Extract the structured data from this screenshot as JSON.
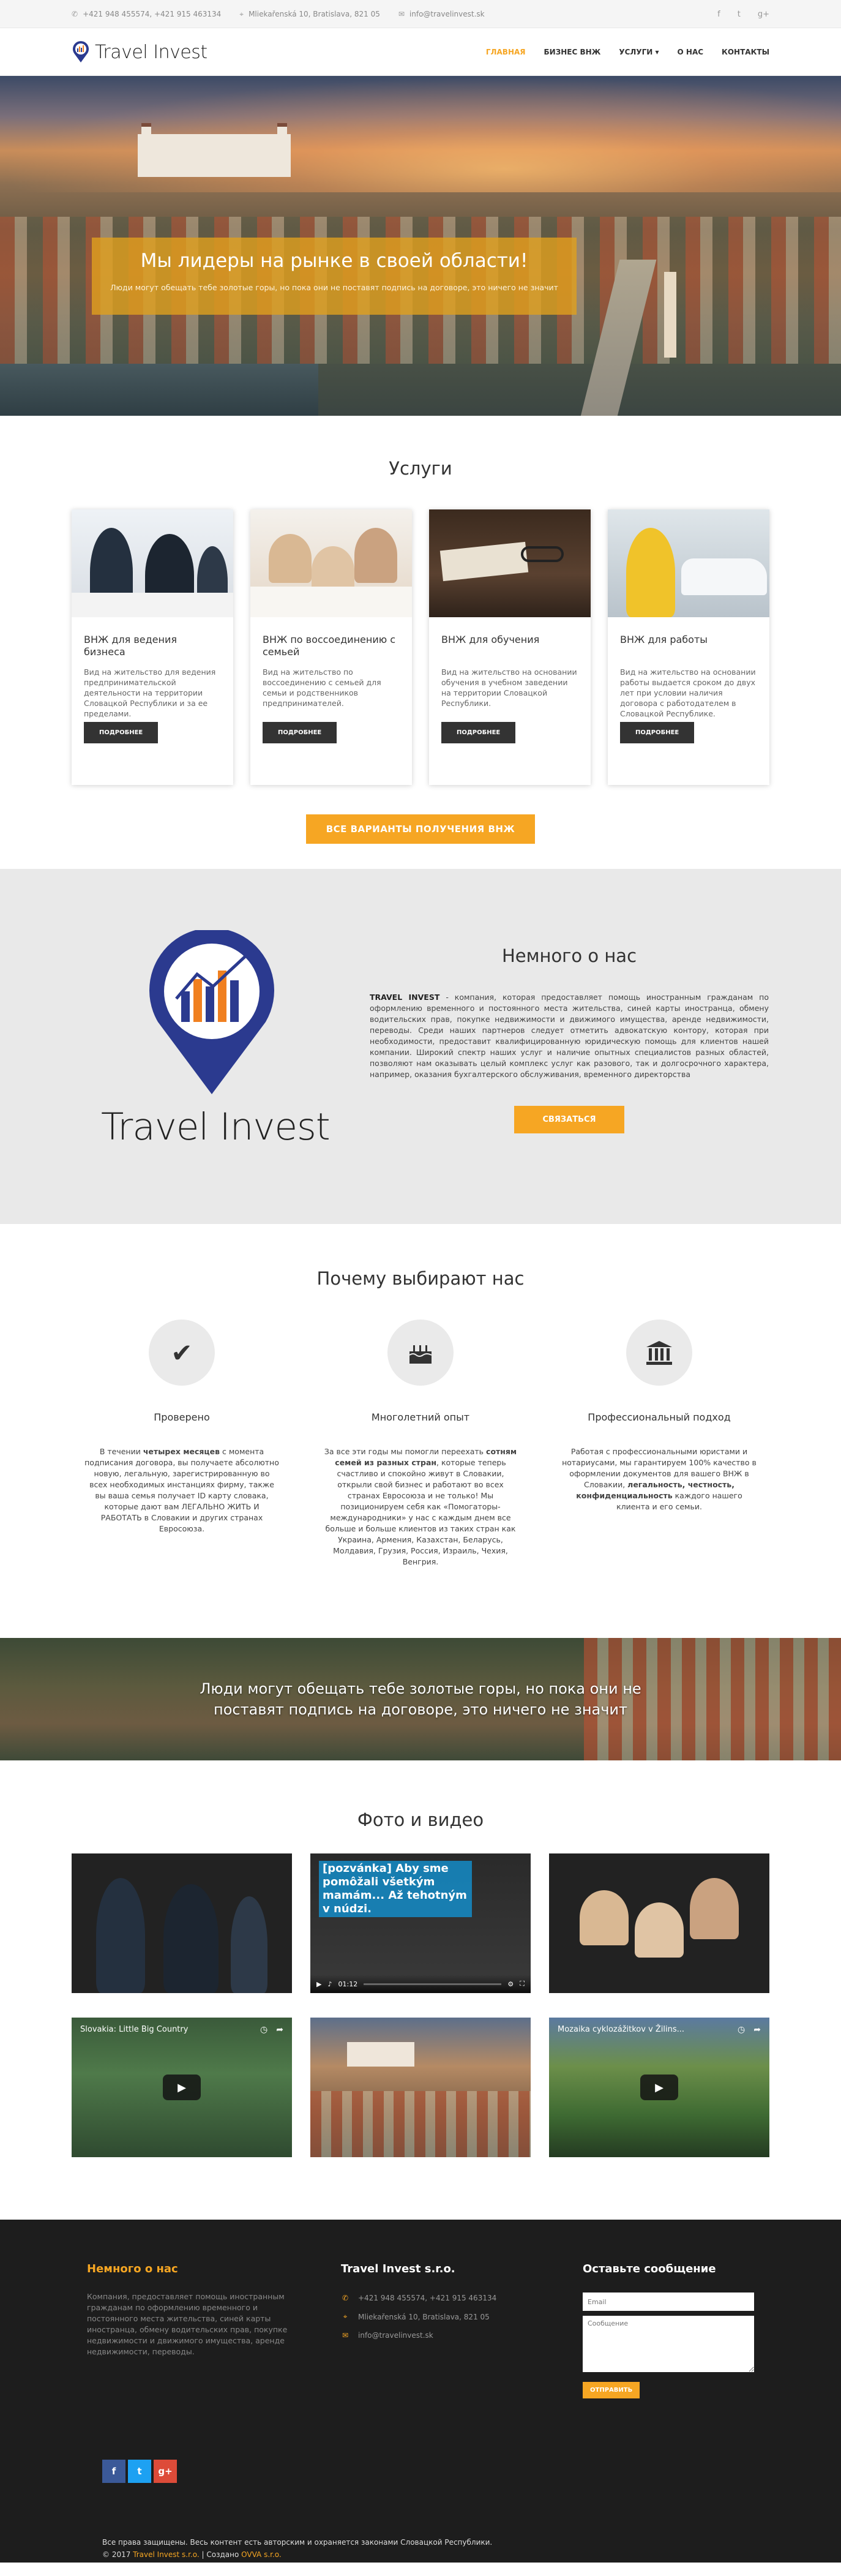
{
  "topbar": {
    "phone": "+421 948 455574, +421 915 463134",
    "address": "Mliekařenská 10, Bratislava, 821 05",
    "email": "info@travelinvest.sk",
    "social": [
      "f",
      "t",
      "g+"
    ]
  },
  "header": {
    "logo_text": "Travel Invest",
    "nav": [
      "Главная",
      "Бизнес ВНЖ",
      "Услуги ▾",
      "О нас",
      "Контакты"
    ]
  },
  "hero": {
    "title": "Мы лидеры на рынке в своей области!",
    "subtitle": "Люди могут обещать тебе золотые горы, но пока они не поставят подпись на договоре, это ничего не значит"
  },
  "services": {
    "title": "Услуги",
    "cards": [
      {
        "title": "ВНЖ для ведения бизнеса",
        "text": "Вид на жительство для ведения предпринимательской деятельности на территории Словацкой Республики и за ее пределами.",
        "button": "Подробнее"
      },
      {
        "title": "ВНЖ по воссоединению с семьей",
        "text": "Вид на жительство по воссоединению с семьей для семьи и родственников предпринимателей.",
        "button": "Подробнее"
      },
      {
        "title": "ВНЖ для обучения",
        "text": "Вид на жительство на основании обучения в учебном заведении на территории Словацкой Республики.",
        "button": "Подробнее"
      },
      {
        "title": "ВНЖ для работы",
        "text": "Вид на жительство на основании работы выдается сроком до двух лет при условии наличия договора с работодателем в Словацкой Республике.",
        "button": "Подробнее"
      }
    ],
    "all_button": "Все варианты получения ВНЖ"
  },
  "about": {
    "logo_text": "Travel Invest",
    "title": "Немного о нас",
    "company": "TRAVEL INVEST",
    "text": " - компания, которая предоставляет помощь иностранным гражданам по оформлению временного и постоянного места жительства, синей карты иностранца, обмену водительских прав, покупке недвижимости и движимого имущества, аренде недвижимости, переводы. Среди наших партнеров следует отметить адвокатскую контору, которая при необходимости, предоставит квалифицированную юридическую помощь для клиентов нашей компании. Широкий спектр наших услуг и наличие опытных специалистов разных областей, позволяют нам оказывать целый комплекс услуг как разового, так и долгосрочного характера, например, оказания бухгалтерского обслуживания, временного директорства",
    "button": "Связаться"
  },
  "why": {
    "title": "Почему выбирают нас",
    "items": [
      {
        "icon": "check-icon",
        "title": "Проверено",
        "pre": "В течении ",
        "bold": "четырех месяцев",
        "post": " с момента подписания договора, вы получаете абсолютно новую, легальную, зарегистрированную во всех необходимых инстанциях фирму, также вы ваша семья получает ID карту словака, которые дают вам ЛЕГАЛЬНО ЖИТЬ И РАБОТАТЬ в Словакии и других странах Евросоюза."
      },
      {
        "icon": "birthday-cake-icon",
        "title": "Многолетний опыт",
        "pre": "За все эти годы мы помогли переехать ",
        "bold": "сотням семей из разных стран",
        "post": ", которые теперь счастливо и спокойно живут в Словакии, открыли свой бизнес и работают во всех странах Евросоюза и не только! Мы позиционируем себя как «Помогаторы-международники» у нас с каждым днем все больше и больше клиентов из таких стран как Украина, Армения, Казахстан, Беларусь, Молдавия, Грузия, Россия, Израиль, Чехия, Венгрия."
      },
      {
        "icon": "institution-icon",
        "title": "Профессиональный подход",
        "pre": "Работая с профессиональными юристами и нотариусами, мы гарантируем 100% качество в оформлении документов для вашего ВНЖ в Словакии, ",
        "bold": "легальность, честность, конфиденциальность",
        "post": " каждого нашего клиента и его семьи."
      }
    ]
  },
  "quote": {
    "line1": "Люди могут обещать тебе золотые горы, но пока они не",
    "line2": "поставят подпись на договоре, это ничего не значит"
  },
  "gallery": {
    "title": "Фото и видео",
    "video1_title": "[pozvánka] Aby sme pomôžali všetkým mamám... Až tehotným v núdzi.",
    "video1_time": "01:12",
    "video2_title": "Slovakia: Little Big Country",
    "video3_title": "Mozaika cyklozážitkov v Žilins..."
  },
  "footer": {
    "about_title": "Немного о нас",
    "about_text": "Компания, предоставляет помощь иностранным гражданам по оформлению временного и постоянного места жительства, синей карты иностранца, обмену водительских прав, покупке недвижимости и движимого имущества, аренде недвижимости, переводы.",
    "company_title": "Travel Invest s.r.o.",
    "phone": "+421 948 455574, +421 915 463134",
    "address": "Mliekařenská 10, Bratislava, 821 05",
    "email": "info@travelinvest.sk",
    "contact_title": "Оставьте сообщение",
    "email_placeholder": "Email",
    "message_placeholder": "Сообщение",
    "send": "Отправить",
    "social": [
      "f",
      "t",
      "g+"
    ],
    "rights": "Все права защищены. Весь контент есть авторским и охраняется законами Словацкой Республики.",
    "copy_prefix": "© 2017 ",
    "copy_company": "Travel Invest s.r.o.",
    "copy_mid": " | Создано ",
    "copy_author": "OVVA s.r.o."
  },
  "colors": {
    "accent": "#f6a623",
    "dark": "#333333",
    "footer_bg": "#1d1d1d",
    "facebook": "#3b5998",
    "twitter": "#1da1f2",
    "google": "#dd4b39"
  }
}
